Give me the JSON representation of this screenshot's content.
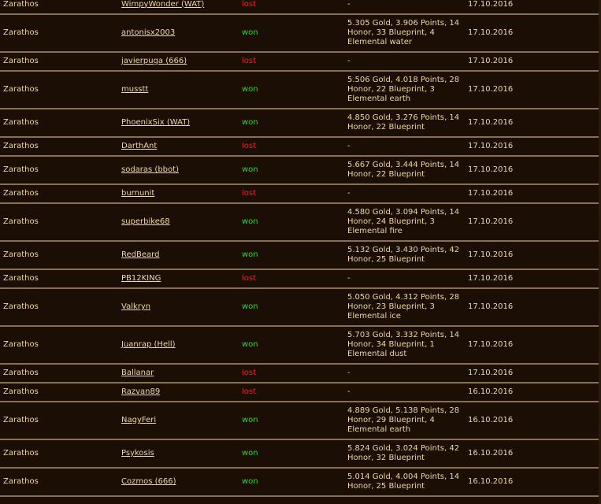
{
  "colors": {
    "background": "#1a0e05",
    "text": "#f2d7a0",
    "won": "#3fce3f",
    "lost": "#e8242a",
    "divider": "#8a7052"
  },
  "rows": [
    {
      "attacker": "Zarathos",
      "opponent": "WimpyWonder (WAT)",
      "result": "lost",
      "loot": "-",
      "date": "17.10.2016"
    },
    {
      "attacker": "Zarathos",
      "opponent": "antonisx2003",
      "result": "won",
      "loot": "5.305 Gold, 3.906 Points, 14 Honor, 33 Blueprint, 4 Elemental water",
      "date": "17.10.2016"
    },
    {
      "attacker": "Zarathos",
      "opponent": "javierpuga (666)",
      "result": "lost",
      "loot": "-",
      "date": "17.10.2016"
    },
    {
      "attacker": "Zarathos",
      "opponent": "musstt",
      "result": "won",
      "loot": "5.506 Gold, 4.018 Points, 28 Honor, 22 Blueprint, 3 Elemental earth",
      "date": "17.10.2016"
    },
    {
      "attacker": "Zarathos",
      "opponent": "PhoenixSix (WAT)",
      "result": "won",
      "loot": "4.850 Gold, 3.276 Points, 14 Honor, 22 Blueprint",
      "date": "17.10.2016"
    },
    {
      "attacker": "Zarathos",
      "opponent": "DarthAnt",
      "result": "lost",
      "loot": "-",
      "date": "17.10.2016"
    },
    {
      "attacker": "Zarathos",
      "opponent": "sodaras (bbot)",
      "result": "won",
      "loot": "5.667 Gold, 3.444 Points, 14 Honor, 22 Blueprint",
      "date": "17.10.2016"
    },
    {
      "attacker": "Zarathos",
      "opponent": "burnunit",
      "result": "lost",
      "loot": "-",
      "date": "17.10.2016"
    },
    {
      "attacker": "Zarathos",
      "opponent": "superbike68",
      "result": "won",
      "loot": "4.580 Gold, 3.094 Points, 14 Honor, 24 Blueprint, 3 Elemental fire",
      "date": "17.10.2016"
    },
    {
      "attacker": "Zarathos",
      "opponent": "RedBeard",
      "result": "won",
      "loot": "5.132 Gold, 3.430 Points, 42 Honor, 25 Blueprint",
      "date": "17.10.2016"
    },
    {
      "attacker": "Zarathos",
      "opponent": "PB12KING",
      "result": "lost",
      "loot": "-",
      "date": "17.10.2016"
    },
    {
      "attacker": "Zarathos",
      "opponent": "Valkryn",
      "result": "won",
      "loot": "5.050 Gold, 4.312 Points, 28 Honor, 23 Blueprint, 3 Elemental ice",
      "date": "17.10.2016"
    },
    {
      "attacker": "Zarathos",
      "opponent": "Juanrap (Hell)",
      "result": "won",
      "loot": "5.703 Gold, 3.332 Points, 14 Honor, 34 Blueprint, 1 Elemental dust",
      "date": "17.10.2016"
    },
    {
      "attacker": "Zarathos",
      "opponent": "Ballanar",
      "result": "lost",
      "loot": "-",
      "date": "17.10.2016"
    },
    {
      "attacker": "Zarathos",
      "opponent": "Razvan89",
      "result": "lost",
      "loot": "-",
      "date": "16.10.2016"
    },
    {
      "attacker": "Zarathos",
      "opponent": "NagyFeri",
      "result": "won",
      "loot": "4.889 Gold, 5.138 Points, 28 Honor, 29 Blueprint, 4 Elemental earth",
      "date": "16.10.2016"
    },
    {
      "attacker": "Zarathos",
      "opponent": "Psykosis",
      "result": "won",
      "loot": "5.824 Gold, 3.024 Points, 42 Honor, 32 Blueprint",
      "date": "16.10.2016"
    },
    {
      "attacker": "Zarathos",
      "opponent": "Cozmos (666)",
      "result": "won",
      "loot": "5.014 Gold, 4.004 Points, 14 Honor, 25 Blueprint",
      "date": "16.10.2016"
    }
  ]
}
